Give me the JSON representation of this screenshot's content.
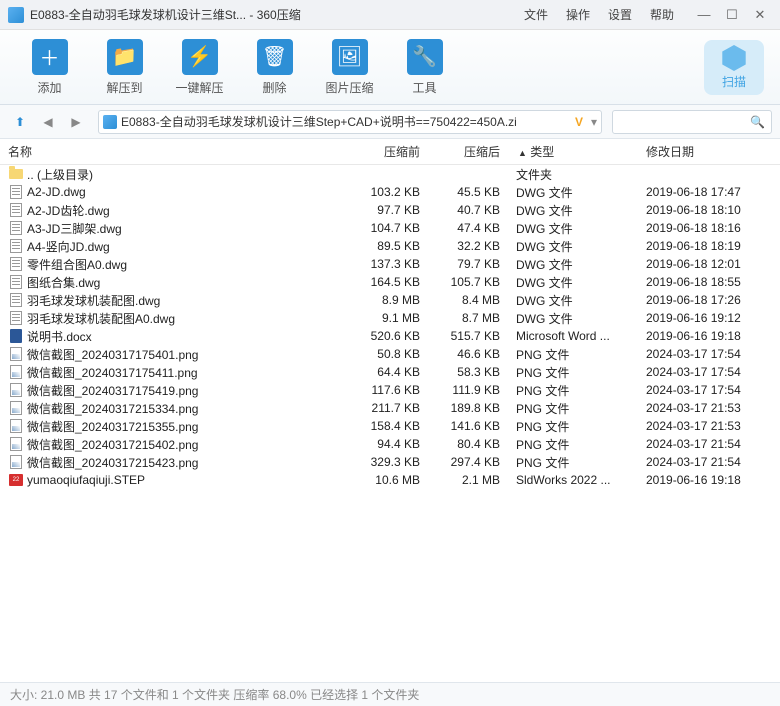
{
  "window": {
    "title": "E0883-全自动羽毛球发球机设计三维St... - 360压缩"
  },
  "menu": {
    "file": "文件",
    "operate": "操作",
    "settings": "设置",
    "help": "帮助"
  },
  "toolbar": {
    "add": "添加",
    "extract": "解压到",
    "oneclick": "一键解压",
    "delete": "删除",
    "imgcompress": "图片压缩",
    "tools": "工具",
    "scan": "扫描"
  },
  "path": "E0883-全自动羽毛球发球机设计三维Step+CAD+说明书==750422=450A.zi",
  "columns": {
    "name": "名称",
    "before": "压缩前",
    "after": "压缩后",
    "type": "类型",
    "date": "修改日期"
  },
  "files": [
    {
      "icon": "folder",
      "name": ".. (上级目录)",
      "before": "",
      "after": "",
      "type": "文件夹",
      "date": ""
    },
    {
      "icon": "dwg",
      "name": "A2-JD.dwg",
      "before": "103.2 KB",
      "after": "45.5 KB",
      "type": "DWG 文件",
      "date": "2019-06-18 17:47"
    },
    {
      "icon": "dwg",
      "name": "A2-JD齿轮.dwg",
      "before": "97.7 KB",
      "after": "40.7 KB",
      "type": "DWG 文件",
      "date": "2019-06-18 18:10"
    },
    {
      "icon": "dwg",
      "name": "A3-JD三脚架.dwg",
      "before": "104.7 KB",
      "after": "47.4 KB",
      "type": "DWG 文件",
      "date": "2019-06-18 18:16"
    },
    {
      "icon": "dwg",
      "name": "A4-竖向JD.dwg",
      "before": "89.5 KB",
      "after": "32.2 KB",
      "type": "DWG 文件",
      "date": "2019-06-18 18:19"
    },
    {
      "icon": "dwg",
      "name": "零件组合图A0.dwg",
      "before": "137.3 KB",
      "after": "79.7 KB",
      "type": "DWG 文件",
      "date": "2019-06-18 12:01"
    },
    {
      "icon": "dwg",
      "name": "图纸合集.dwg",
      "before": "164.5 KB",
      "after": "105.7 KB",
      "type": "DWG 文件",
      "date": "2019-06-18 18:55"
    },
    {
      "icon": "dwg",
      "name": "羽毛球发球机装配图.dwg",
      "before": "8.9 MB",
      "after": "8.4 MB",
      "type": "DWG 文件",
      "date": "2019-06-18 17:26"
    },
    {
      "icon": "dwg",
      "name": "羽毛球发球机装配图A0.dwg",
      "before": "9.1 MB",
      "after": "8.7 MB",
      "type": "DWG 文件",
      "date": "2019-06-16 19:12"
    },
    {
      "icon": "docx",
      "name": "说明书.docx",
      "before": "520.6 KB",
      "after": "515.7 KB",
      "type": "Microsoft Word ...",
      "date": "2019-06-16 19:18"
    },
    {
      "icon": "png",
      "name": "微信截图_20240317175401.png",
      "before": "50.8 KB",
      "after": "46.6 KB",
      "type": "PNG 文件",
      "date": "2024-03-17 17:54"
    },
    {
      "icon": "png",
      "name": "微信截图_20240317175411.png",
      "before": "64.4 KB",
      "after": "58.3 KB",
      "type": "PNG 文件",
      "date": "2024-03-17 17:54"
    },
    {
      "icon": "png",
      "name": "微信截图_20240317175419.png",
      "before": "117.6 KB",
      "after": "111.9 KB",
      "type": "PNG 文件",
      "date": "2024-03-17 17:54"
    },
    {
      "icon": "png",
      "name": "微信截图_20240317215334.png",
      "before": "211.7 KB",
      "after": "189.8 KB",
      "type": "PNG 文件",
      "date": "2024-03-17 21:53"
    },
    {
      "icon": "png",
      "name": "微信截图_20240317215355.png",
      "before": "158.4 KB",
      "after": "141.6 KB",
      "type": "PNG 文件",
      "date": "2024-03-17 21:53"
    },
    {
      "icon": "png",
      "name": "微信截图_20240317215402.png",
      "before": "94.4 KB",
      "after": "80.4 KB",
      "type": "PNG 文件",
      "date": "2024-03-17 21:54"
    },
    {
      "icon": "png",
      "name": "微信截图_20240317215423.png",
      "before": "329.3 KB",
      "after": "297.4 KB",
      "type": "PNG 文件",
      "date": "2024-03-17 21:54"
    },
    {
      "icon": "step",
      "name": "yumaoqiufaqiuji.STEP",
      "before": "10.6 MB",
      "after": "2.1 MB",
      "type": "SldWorks 2022 ...",
      "date": "2019-06-16 19:18"
    }
  ],
  "status": "大小: 21.0 MB 共 17 个文件和 1 个文件夹 压缩率 68.0% 已经选择 1 个文件夹"
}
